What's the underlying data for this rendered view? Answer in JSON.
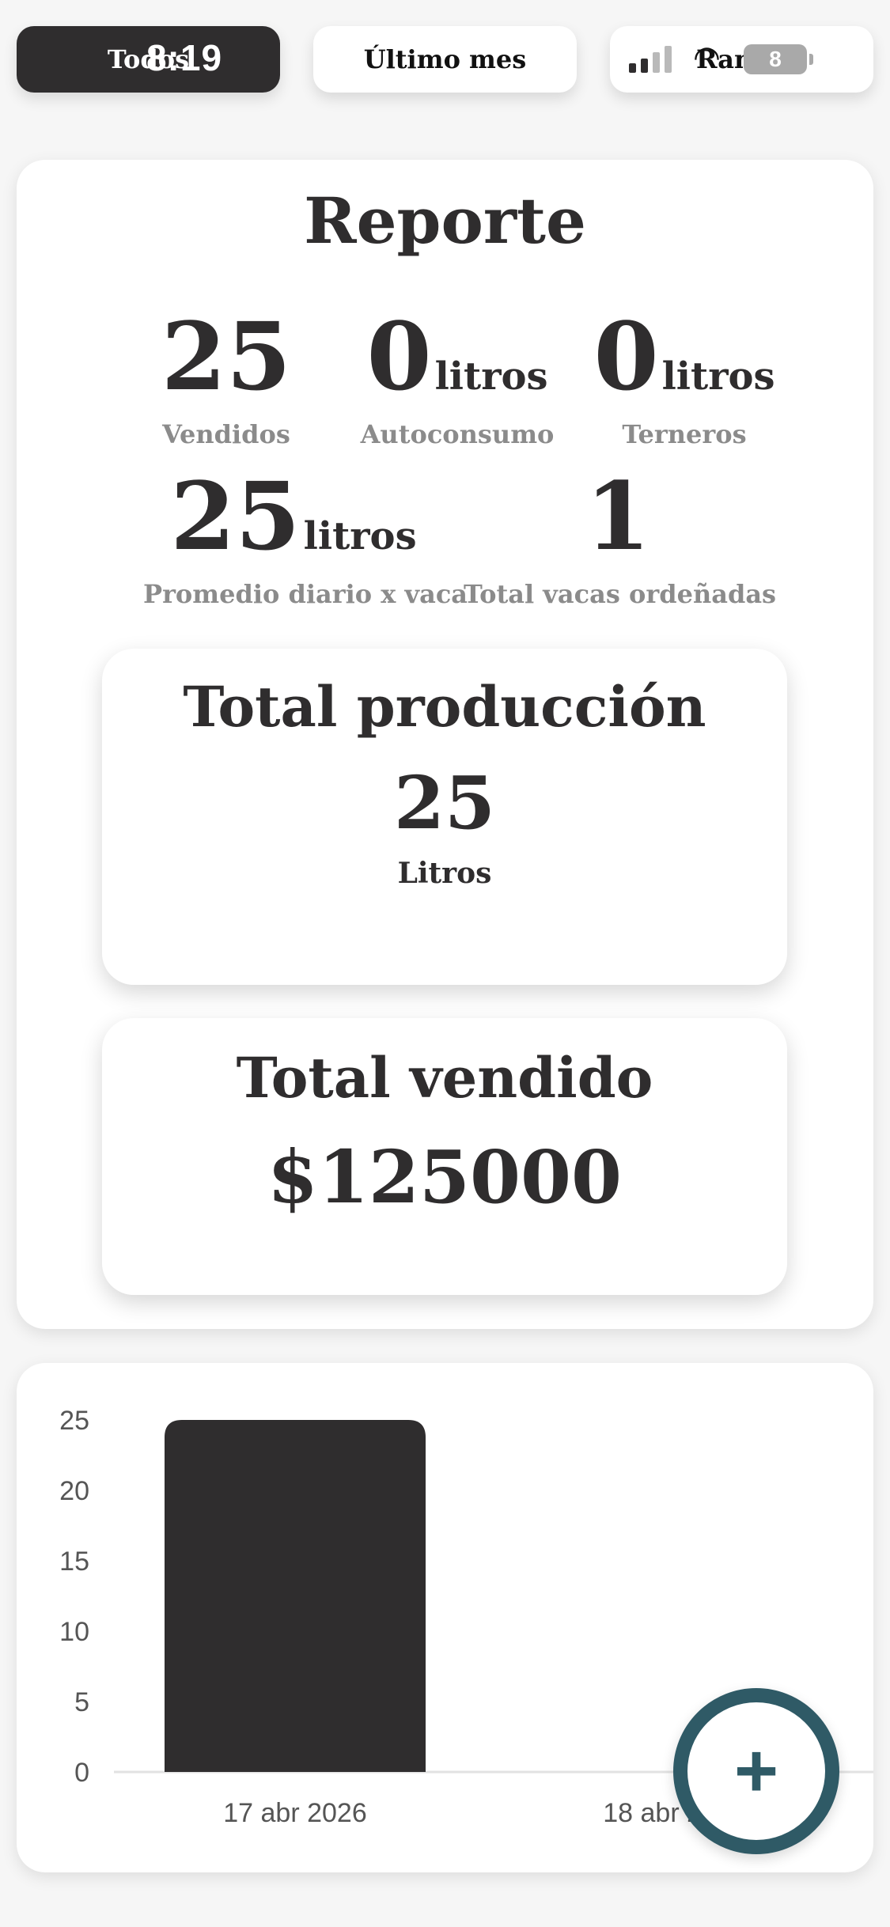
{
  "status_bar": {
    "time": "8:19",
    "battery": "8"
  },
  "filters": [
    {
      "label": "Todos",
      "active": true
    },
    {
      "label": "Último mes",
      "active": false
    },
    {
      "label": "Rango",
      "active": false
    }
  ],
  "report": {
    "title": "Reporte",
    "vendidos": {
      "value": "25",
      "unit": "",
      "label": "Vendidos"
    },
    "autoconsumo": {
      "value": "0",
      "unit": "litros",
      "label": "Autoconsumo"
    },
    "terneros": {
      "value": "0",
      "unit": "litros",
      "label": "Terneros"
    },
    "promedio": {
      "value": "25",
      "unit": "litros",
      "label": "Promedio diario x vaca"
    },
    "vacas": {
      "value": "1",
      "label": "Total vacas ordeñadas"
    }
  },
  "total_produccion": {
    "title": "Total producción",
    "value": "25",
    "unit": "Litros"
  },
  "total_vendido": {
    "title": "Total vendido",
    "value": "$125000"
  },
  "chart_data": {
    "type": "bar",
    "categories": [
      "17 abr 2026",
      "18 abr 2026"
    ],
    "values": [
      25,
      0
    ],
    "title": "",
    "xlabel": "",
    "ylabel": "",
    "ylim": [
      0,
      25
    ],
    "yticks": [
      0,
      5,
      10,
      15,
      20,
      25
    ],
    "bar_color": "#2f2d2e",
    "grid": false
  },
  "fab": {
    "label": "+"
  }
}
